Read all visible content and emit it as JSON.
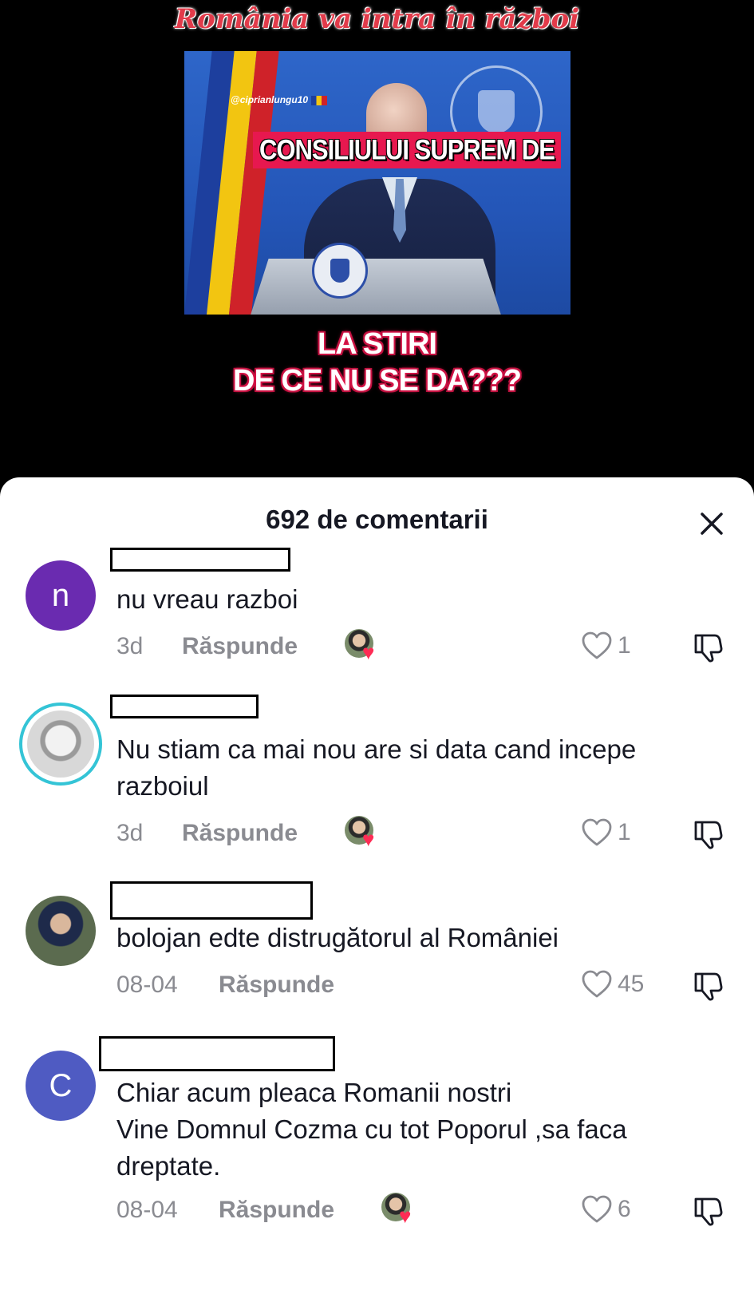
{
  "video": {
    "title": "România va intra în război",
    "handle": "@ciprianlungu10",
    "caption": "CONSILIULUI SUPREM DE",
    "subtitle_line1": "LA STIRI",
    "subtitle_line2": "DE CE NU SE DA???"
  },
  "comments_sheet": {
    "title": "692 de comentarii",
    "close_icon": "close-icon",
    "reply_label": "Răspunde"
  },
  "comments": [
    {
      "avatar_letter": "n",
      "avatar_color": "#6a2bb0",
      "text_lines": [
        "nu vreau razboi"
      ],
      "date": "3d",
      "creator_liked": true,
      "likes": "1"
    },
    {
      "avatar_letter": "",
      "avatar_color": "#dcdcdc",
      "text_lines": [
        "Nu stiam ca mai nou are si data cand incepe",
        "razboiul"
      ],
      "date": "3d",
      "creator_liked": true,
      "likes": "1"
    },
    {
      "avatar_letter": "",
      "avatar_color": "#5b6b4f",
      "text_lines": [
        "bolojan edte distrugătorul al României"
      ],
      "date": "08-04",
      "creator_liked": false,
      "likes": "45"
    },
    {
      "avatar_letter": "C",
      "avatar_color": "#4f5bc2",
      "text_lines": [
        "Chiar acum pleaca Romanii nostri",
        "Vine Domnul Cozma cu tot Poporul ,sa faca",
        "dreptate."
      ],
      "date": "08-04",
      "creator_liked": true,
      "likes": "6"
    }
  ]
}
